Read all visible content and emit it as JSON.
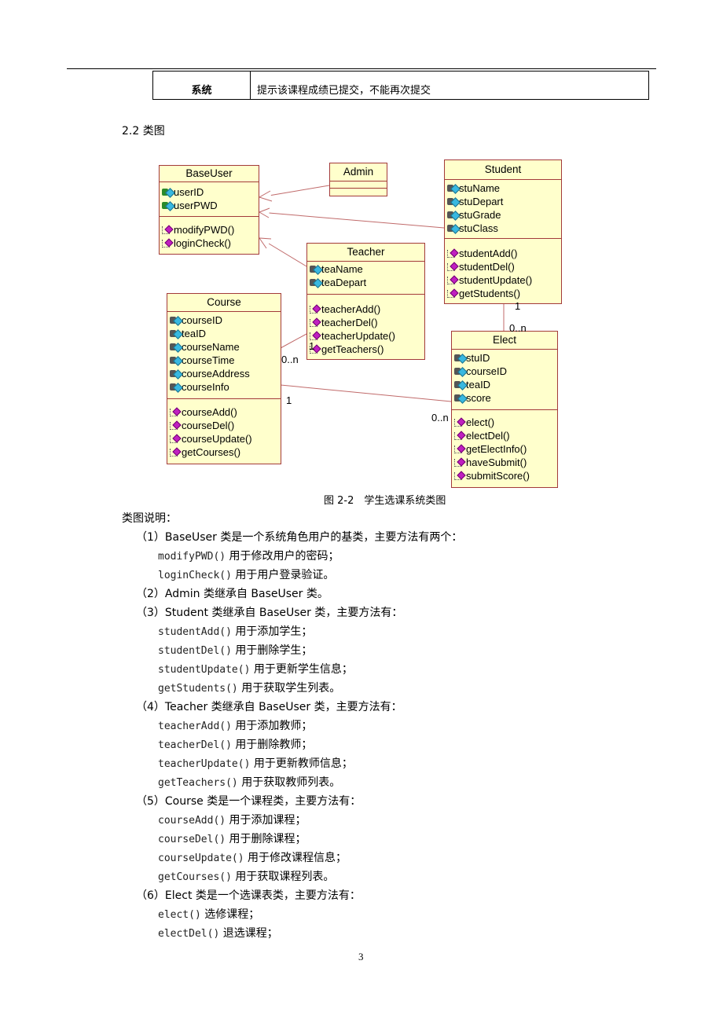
{
  "table": {
    "role": "系统",
    "message": "提示该课程成绩已提交，不能再次提交"
  },
  "section_title": "2.2 类图",
  "diagram": {
    "caption": "图 2-2　学生选课系统类图",
    "classes": {
      "baseuser": {
        "name": "BaseUser",
        "attrs": [
          "userID",
          "userPWD"
        ],
        "methods": [
          "modifyPWD()",
          "loginCheck()"
        ]
      },
      "admin": {
        "name": "Admin"
      },
      "student": {
        "name": "Student",
        "attrs": [
          "stuName",
          "stuDepart",
          "stuGrade",
          "stuClass"
        ],
        "methods": [
          "studentAdd()",
          "studentDel()",
          "studentUpdate()",
          "getStudents()"
        ]
      },
      "teacher": {
        "name": "Teacher",
        "attrs": [
          "teaName",
          "teaDepart"
        ],
        "methods": [
          "teacherAdd()",
          "teacherDel()",
          "teacherUpdate()",
          "getTeachers()"
        ]
      },
      "course": {
        "name": "Course",
        "attrs": [
          "courseID",
          "teaID",
          "courseName",
          "courseTime",
          "courseAddress",
          "courseInfo"
        ],
        "methods": [
          "courseAdd()",
          "courseDel()",
          "courseUpdate()",
          "getCourses()"
        ]
      },
      "elect": {
        "name": "Elect",
        "attrs": [
          "stuID",
          "courseID",
          "teaID",
          "score"
        ],
        "methods": [
          "elect()",
          "electDel()",
          "getElectInfo()",
          "haveSubmit()",
          "submitScore()"
        ]
      }
    },
    "multiplicities": {
      "student_elect_one": "1",
      "student_elect_many": "0..n",
      "teacher_course_one": "1",
      "teacher_course_many": "0..n",
      "course_elect_one": "1",
      "course_elect_many": "0..n"
    }
  },
  "description": {
    "heading": "类图说明：",
    "items": [
      {
        "title": "（1）BaseUser 类是一个系统角色用户的基类，主要方法有两个：",
        "lines": [
          {
            "code": "modifyPWD()",
            "text": " 用于修改用户的密码；"
          },
          {
            "code": "loginCheck()",
            "text": " 用于用户登录验证。"
          }
        ]
      },
      {
        "title": "（2）Admin 类继承自 BaseUser 类。",
        "lines": []
      },
      {
        "title": "（3）Student 类继承自 BaseUser 类，主要方法有：",
        "lines": [
          {
            "code": "studentAdd()",
            "text": " 用于添加学生；"
          },
          {
            "code": "studentDel()",
            "text": " 用于删除学生；"
          },
          {
            "code": "studentUpdate()",
            "text": " 用于更新学生信息；"
          },
          {
            "code": "getStudents()",
            "text": " 用于获取学生列表。"
          }
        ]
      },
      {
        "title": "（4）Teacher 类继承自 BaseUser 类，主要方法有：",
        "lines": [
          {
            "code": "teacherAdd()",
            "text": " 用于添加教师；"
          },
          {
            "code": "teacherDel()",
            "text": " 用于删除教师；"
          },
          {
            "code": "teacherUpdate()",
            "text": " 用于更新教师信息；"
          },
          {
            "code": "getTeachers()",
            "text": " 用于获取教师列表。"
          }
        ]
      },
      {
        "title": "（5）Course 类是一个课程类，主要方法有：",
        "lines": [
          {
            "code": "courseAdd()",
            "text": " 用于添加课程；"
          },
          {
            "code": "courseDel()",
            "text": " 用于删除课程；"
          },
          {
            "code": "courseUpdate()",
            "text": " 用于修改课程信息；"
          },
          {
            "code": "getCourses()",
            "text": " 用于获取课程列表。"
          }
        ]
      },
      {
        "title": "（6）Elect 类是一个选课表类，主要方法有：",
        "lines": [
          {
            "code": "elect()",
            "text": " 选修课程；"
          },
          {
            "code": "electDel()",
            "text": " 退选课程；"
          }
        ]
      }
    ]
  },
  "page_number": "3"
}
